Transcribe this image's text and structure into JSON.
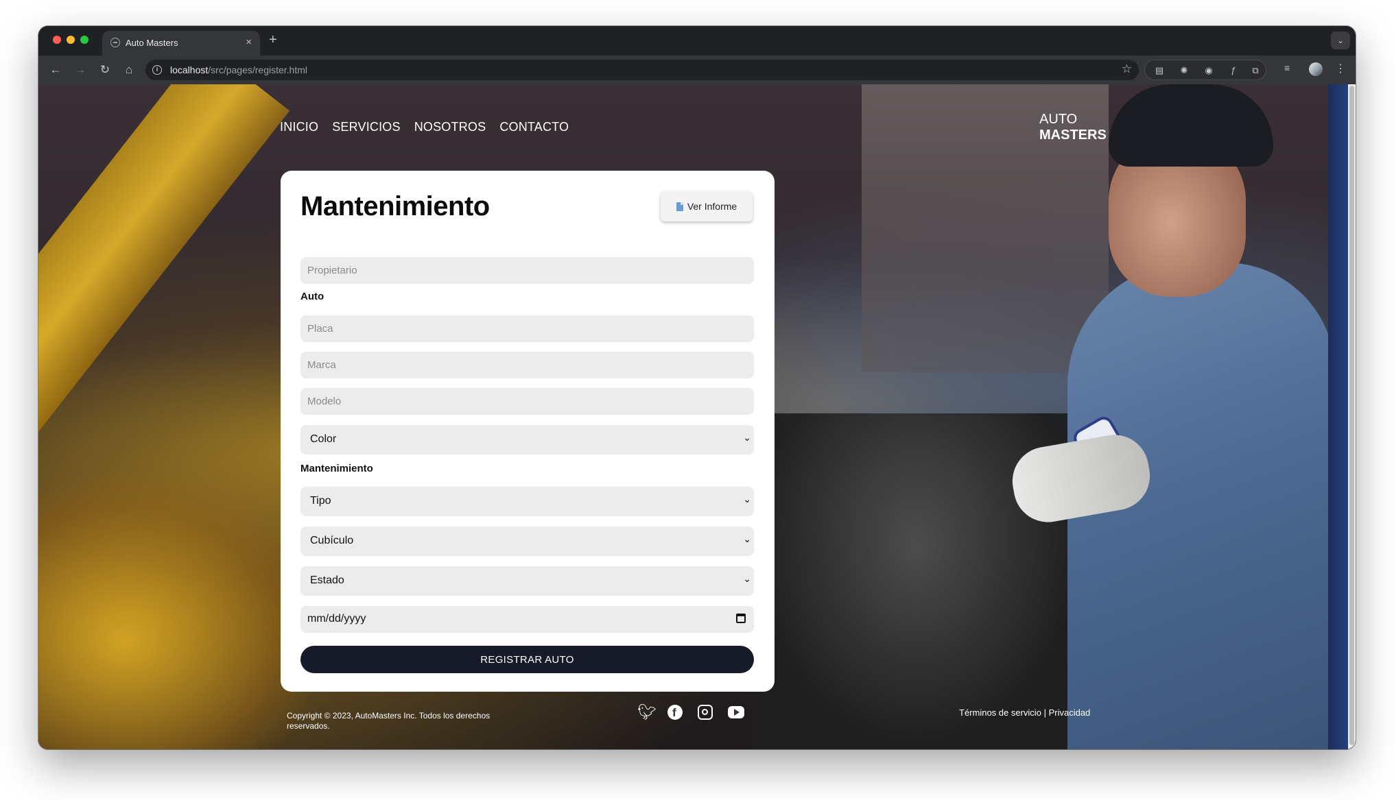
{
  "browser": {
    "tab_title": "Auto Masters",
    "tab_close": "×",
    "new_tab": "+",
    "url_host": "localhost",
    "url_path": "/src/pages/register.html"
  },
  "site": {
    "nav": [
      "INICIO",
      "SERVICIOS",
      "NOSOTROS",
      "CONTACTO"
    ],
    "brand_line1": "AUTO",
    "brand_line2": "MASTERS"
  },
  "form": {
    "title": "Mantenimiento",
    "report_button": "Ver Informe",
    "owner_placeholder": "Propietario",
    "car_section": "Auto",
    "plate_placeholder": "Placa",
    "make_placeholder": "Marca",
    "model_placeholder": "Modelo",
    "color_select": "Color",
    "maintenance_section": "Mantenimiento",
    "type_select": "Tipo",
    "cubicle_select": "Cubículo",
    "status_select": "Estado",
    "date_placeholder": "mm/dd/yyyy",
    "submit_label": "REGISTRAR AUTO"
  },
  "footer": {
    "copyright": "Copyright © 2023, AutoMasters Inc. Todos los derechos reservados.",
    "terms": "Términos de servicio",
    "separator": "|",
    "privacy": "Privacidad",
    "social_icons": [
      "twitter-icon",
      "facebook-icon",
      "instagram-icon",
      "youtube-icon"
    ]
  },
  "colors": {
    "submit_bg": "#171a28",
    "card_bg": "#ffffff",
    "field_bg": "#ececec"
  }
}
